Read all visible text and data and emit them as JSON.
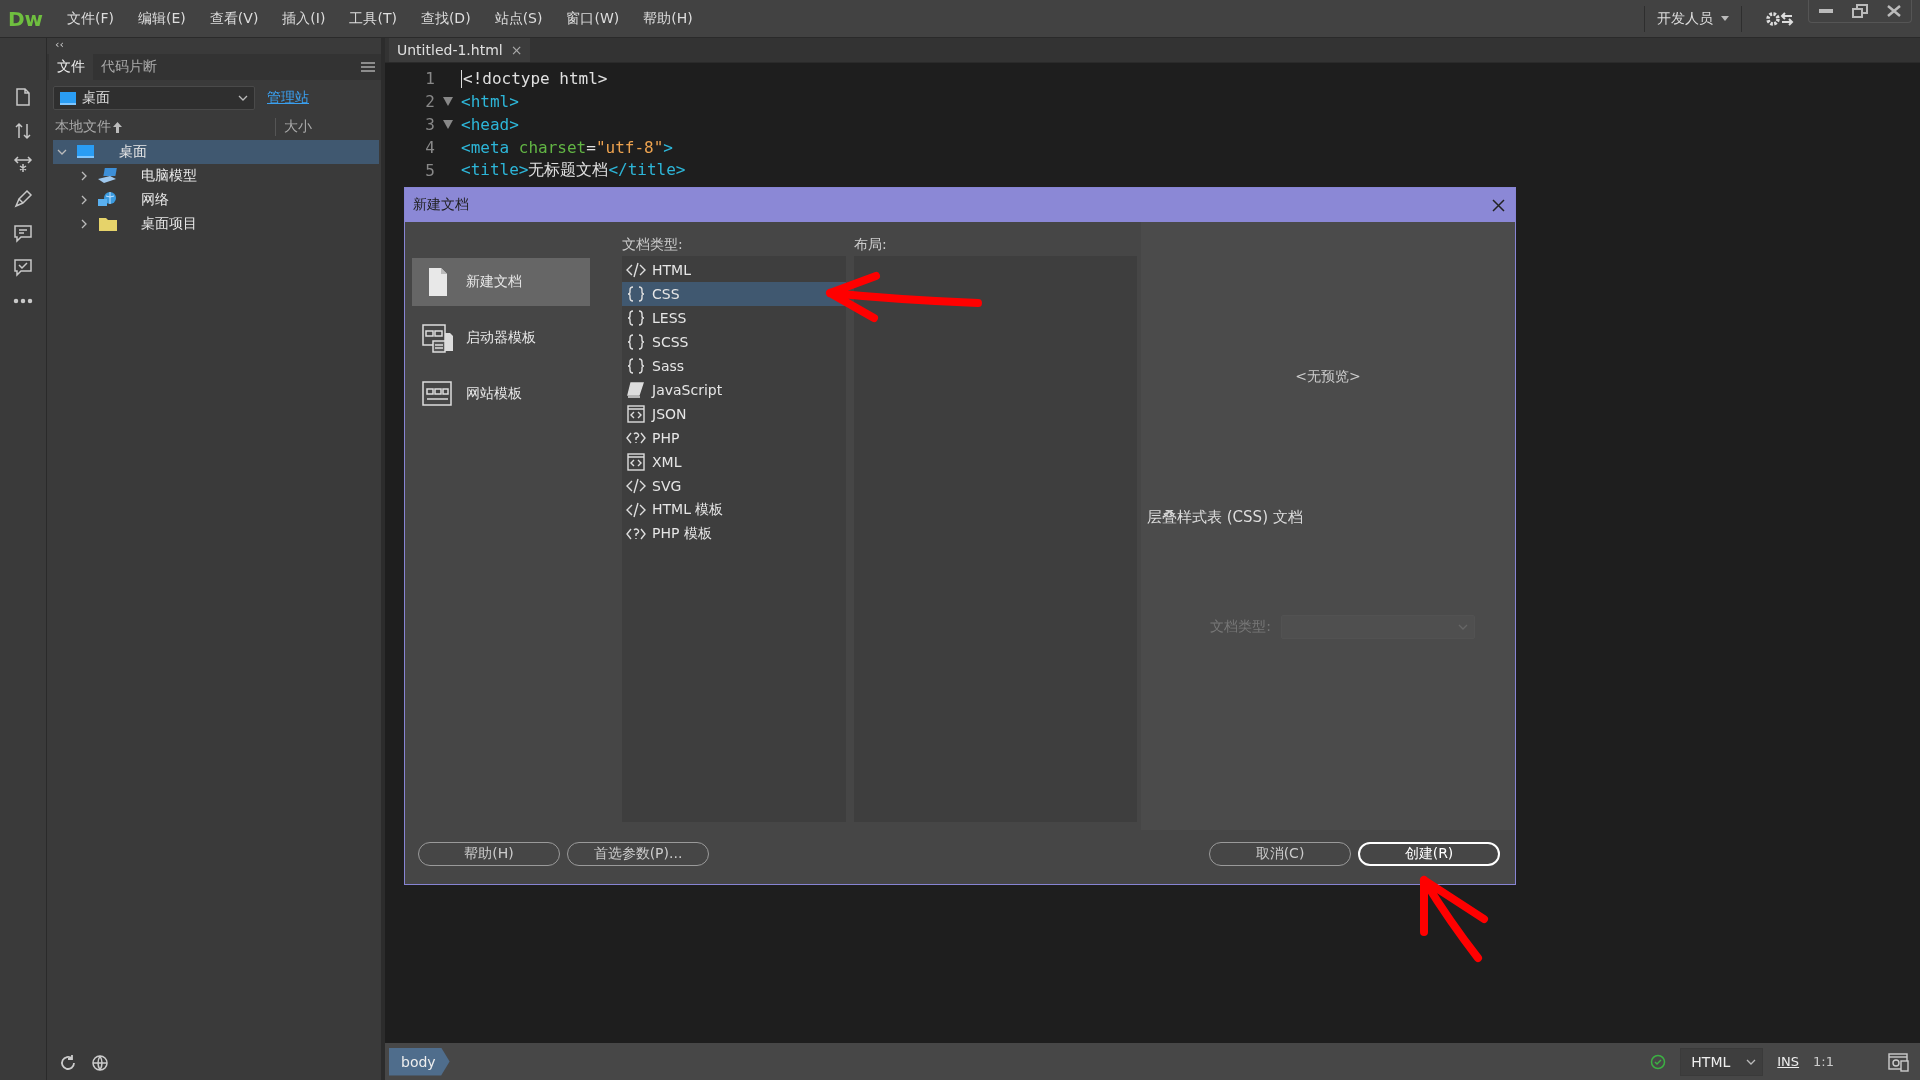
{
  "app": {
    "logo": "Dw"
  },
  "menu": [
    "文件(F)",
    "编辑(E)",
    "查看(V)",
    "插入(I)",
    "工具(T)",
    "查找(D)",
    "站点(S)",
    "窗口(W)",
    "帮助(H)"
  ],
  "workspace": {
    "label": "开发人员"
  },
  "toolbar": [
    {
      "kind": "file"
    },
    {
      "kind": "transfer"
    },
    {
      "kind": "expand"
    },
    {
      "kind": "brush"
    },
    {
      "kind": "comment"
    },
    {
      "kind": "comment-check"
    },
    {
      "kind": "more"
    }
  ],
  "files_panel": {
    "collapse": "‹‹",
    "tabs": [
      {
        "label": "文件",
        "selected": true
      },
      {
        "label": "代码片断",
        "selected": false
      }
    ],
    "site": "桌面",
    "manage_link": "管理站",
    "columns": [
      "本地文件",
      "大小"
    ],
    "tree": [
      {
        "label": "桌面",
        "kind": "desktop",
        "expanded": true,
        "selected": true,
        "children": [
          {
            "label": "电脑模型",
            "kind": "computer",
            "expanded": false,
            "selected": false
          },
          {
            "label": "网络",
            "kind": "network",
            "expanded": false,
            "selected": false
          },
          {
            "label": "桌面项目",
            "kind": "folder",
            "expanded": false,
            "selected": false
          }
        ]
      }
    ]
  },
  "editor": {
    "tab": "Untitled-1.html",
    "close": "×",
    "lines": [
      {
        "number": "1",
        "foldable": false,
        "tokens": [
          {
            "kind": "text",
            "text": "<!doctype html>"
          }
        ]
      },
      {
        "number": "2",
        "foldable": true,
        "tokens": [
          {
            "kind": "tag",
            "text": "<html>"
          }
        ]
      },
      {
        "number": "3",
        "foldable": true,
        "tokens": [
          {
            "kind": "tag",
            "text": "<head>"
          }
        ]
      },
      {
        "number": "4",
        "foldable": false,
        "tokens": [
          {
            "kind": "tag",
            "text": "<meta "
          },
          {
            "kind": "attr",
            "text": "charset"
          },
          {
            "kind": "text",
            "text": "="
          },
          {
            "kind": "string",
            "text": "\"utf-8\""
          },
          {
            "kind": "tag",
            "text": ">"
          }
        ]
      },
      {
        "number": "5",
        "foldable": false,
        "tokens": [
          {
            "kind": "tag",
            "text": "<title>"
          },
          {
            "kind": "text",
            "text": "无标题文档"
          },
          {
            "kind": "tag",
            "text": "</title>"
          }
        ]
      }
    ]
  },
  "dialog": {
    "title": "新建文档",
    "categories": [
      {
        "label": "新建文档",
        "kind": "page",
        "selected": true
      },
      {
        "label": "启动器模板",
        "kind": "starter",
        "selected": false
      },
      {
        "label": "网站模板",
        "kind": "site",
        "selected": false
      }
    ],
    "doc_type_label": "文档类型:",
    "doc_types": [
      {
        "label": "HTML",
        "kind": "markup",
        "selected": false
      },
      {
        "label": "CSS",
        "kind": "braces",
        "selected": true
      },
      {
        "label": "LESS",
        "kind": "braces",
        "selected": false
      },
      {
        "label": "SCSS",
        "kind": "braces",
        "selected": false
      },
      {
        "label": "Sass",
        "kind": "braces",
        "selected": false
      },
      {
        "label": "JavaScript",
        "kind": "script",
        "selected": false
      },
      {
        "label": "JSON",
        "kind": "boxed",
        "selected": false
      },
      {
        "label": "PHP",
        "kind": "php",
        "selected": false
      },
      {
        "label": "XML",
        "kind": "boxed",
        "selected": false
      },
      {
        "label": "SVG",
        "kind": "markup",
        "selected": false
      },
      {
        "label": "HTML 模板",
        "kind": "markup",
        "selected": false
      },
      {
        "label": "PHP 模板",
        "kind": "php",
        "selected": false
      }
    ],
    "layout_label": "布局:",
    "preview_text": "<无预览>",
    "description": "层叠样式表 (CSS) 文档",
    "doctype_field": {
      "label": "文档类型:",
      "disabled": true
    },
    "buttons": [
      {
        "label": "帮助(H)",
        "default": false
      },
      {
        "label": "首选参数(P)...",
        "default": false
      },
      {
        "label": "取消(C)",
        "default": false
      },
      {
        "label": "创建(R)",
        "default": true
      }
    ]
  },
  "annotations": [
    {
      "kind": "arrow-left"
    },
    {
      "kind": "arrow-up"
    }
  ],
  "status_bar": {
    "tag": "body",
    "valid": true,
    "language": "HTML",
    "mode": "INS",
    "position": "1:1"
  }
}
